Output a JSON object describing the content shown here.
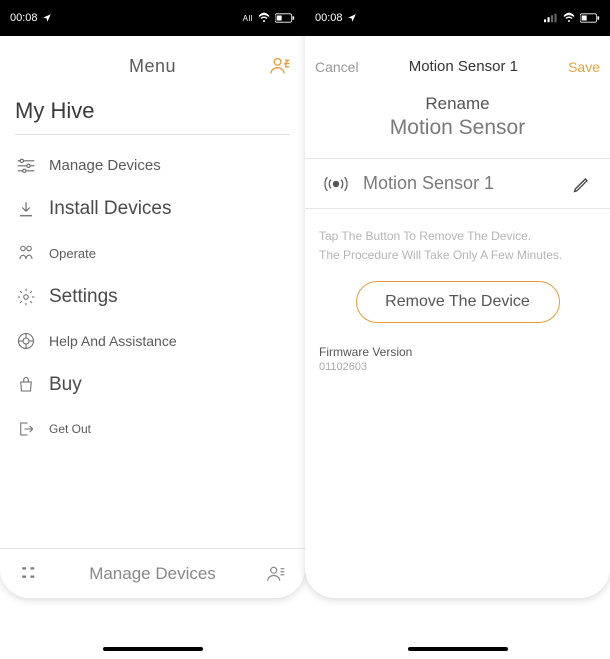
{
  "status_bar": {
    "time": "00:08"
  },
  "left": {
    "header_title": "Menu",
    "section": "My Hive",
    "items": [
      {
        "label": "Manage Devices"
      },
      {
        "label": "Install Devices"
      },
      {
        "label": "Operate"
      },
      {
        "label": "Settings"
      },
      {
        "label": "Help And Assistance"
      },
      {
        "label": "Buy"
      },
      {
        "label": "Get Out"
      }
    ],
    "bottom_title": "Manage Devices"
  },
  "right": {
    "cancel": "Cancel",
    "save": "Save",
    "header_title": "Motion Sensor 1",
    "rename": "Rename",
    "rename_sub": "Motion Sensor",
    "field_value": "Motion Sensor 1",
    "hint_line1": "Tap The Button To Remove The Device.",
    "hint_line2": "The Procedure Will Take Only A Few Minutes.",
    "remove_btn": "Remove The Device",
    "fw_label": "Firmware Version",
    "fw_value": "01102603"
  }
}
